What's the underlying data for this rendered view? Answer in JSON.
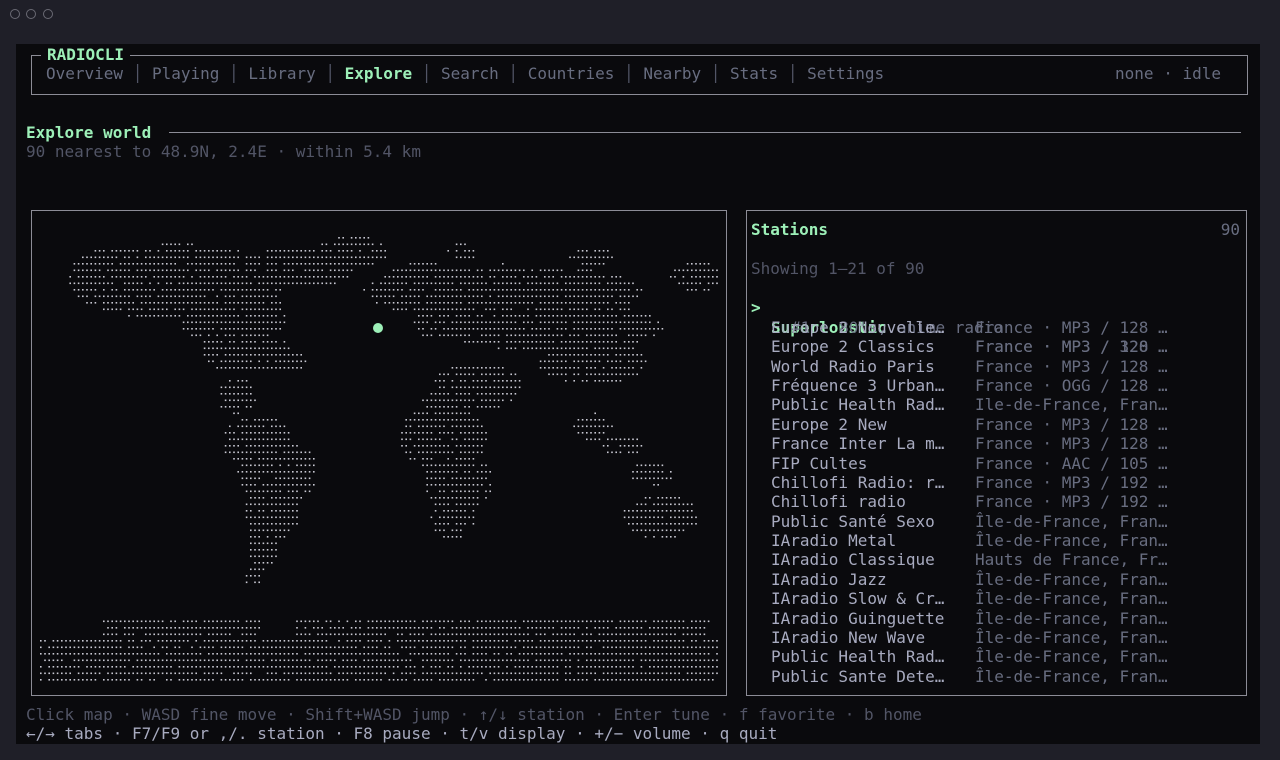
{
  "app_title": "RADIOCLI",
  "tabs": [
    "Overview",
    "Playing",
    "Library",
    "Explore",
    "Search",
    "Countries",
    "Nearby",
    "Stats",
    "Settings"
  ],
  "status": "none · idle",
  "section": {
    "title": "Explore world",
    "subtitle": "90 nearest to 48.9N, 2.4E · within 5.4 km"
  },
  "map": {
    "marker_color": "#9df0b8",
    "dot_color": "#c8c8d2"
  },
  "stations": {
    "title": "Stations",
    "count": "90",
    "showing": "Showing 1–21 of 90",
    "cursor": ">",
    "selected_detail": "#1 · 80's, anime radio",
    "rows": [
      {
        "name": "Superloustic",
        "meta": "France · MP3 / 320 …"
      },
      {
        "name": "Europe 2 Nouvelle…",
        "meta": "France · MP3 / 128 …"
      },
      {
        "name": "Europe 2 Classics",
        "meta": "France · MP3 / 128 …"
      },
      {
        "name": "World Radio Paris",
        "meta": "France · MP3 / 128 …"
      },
      {
        "name": "Fréquence 3 Urban…",
        "meta": "France · OGG / 128 …"
      },
      {
        "name": "Public Health Rad…",
        "meta": "Ile-de-France, Fran…"
      },
      {
        "name": "Europe 2 New",
        "meta": "France · MP3 / 128 …"
      },
      {
        "name": "France Inter La m…",
        "meta": "France · MP3 / 128 …"
      },
      {
        "name": "FIP Cultes",
        "meta": "France · AAC / 105 …"
      },
      {
        "name": "Chillofi Radio: r…",
        "meta": "France · MP3 / 192 …"
      },
      {
        "name": "Chillofi radio",
        "meta": "France · MP3 / 192 …"
      },
      {
        "name": "Public Santé Sexo",
        "meta": "Île-de-France, Fran…"
      },
      {
        "name": "IAradio Metal",
        "meta": "Île-de-France, Fran…"
      },
      {
        "name": "IAradio Classique",
        "meta": "Hauts de France, Fr…"
      },
      {
        "name": "IAradio Jazz",
        "meta": "Île-de-France, Fran…"
      },
      {
        "name": "IAradio Slow & Cr…",
        "meta": "Île-de-France, Fran…"
      },
      {
        "name": "IAradio Guinguette",
        "meta": "Île-de-France, Fran…"
      },
      {
        "name": "IAradio New Wave",
        "meta": "Île-de-France, Fran…"
      },
      {
        "name": "Public Health Rad…",
        "meta": "Île-de-France, Fran…"
      },
      {
        "name": "Public Sante Dete…",
        "meta": "Île-de-France, Fran…"
      }
    ]
  },
  "help": {
    "line1": "Click map · WASD fine move · Shift+WASD jump · ↑/↓ station · Enter tune · f favorite · b home",
    "line2": "←/→ tabs · F7/F9 or ,/. station · F8 pause · t/v display · +/− volume · q quit"
  }
}
